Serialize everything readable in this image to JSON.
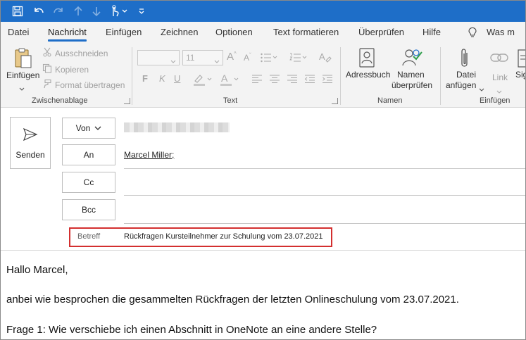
{
  "tabs": [
    "Datei",
    "Nachricht",
    "Einfügen",
    "Zeichnen",
    "Optionen",
    "Text formatieren",
    "Überprüfen",
    "Hilfe",
    "Was m"
  ],
  "active_tab": "Nachricht",
  "accent_color": "#1e6ec8",
  "highlight_color": "#d32f2f",
  "ribbon": {
    "clipboard": {
      "paste_label": "Einfügen",
      "cut_label": "Ausschneiden",
      "copy_label": "Kopieren",
      "format_painter_label": "Format übertragen",
      "group_label": "Zwischenablage"
    },
    "text": {
      "font_size": "11",
      "group_label": "Text"
    },
    "names": {
      "address_book_label": "Adressbuch",
      "check_names_label_1": "Namen",
      "check_names_label_2": "überprüfen",
      "group_label": "Namen"
    },
    "include": {
      "attach_file_label_1": "Datei",
      "attach_file_label_2": "anfügen",
      "link_label": "Link",
      "signature_label": "Sig",
      "group_label": "Einfügen"
    }
  },
  "compose": {
    "send_label": "Senden",
    "from_label": "Von",
    "to_label": "An",
    "cc_label": "Cc",
    "bcc_label": "Bcc",
    "to_value": "Marcel Miller;",
    "subject_label": "Betreff",
    "subject_value": "Rückfragen Kursteilnehmer zur Schulung vom 23.07.2021"
  },
  "body": {
    "line1": "Hallo Marcel,",
    "line2": "anbei wie besprochen die gesammelten Rückfragen der letzten Onlineschulung vom 23.07.2021.",
    "line3": "Frage 1: Wie verschiebe ich einen Abschnitt in OneNote an eine andere Stelle?"
  }
}
